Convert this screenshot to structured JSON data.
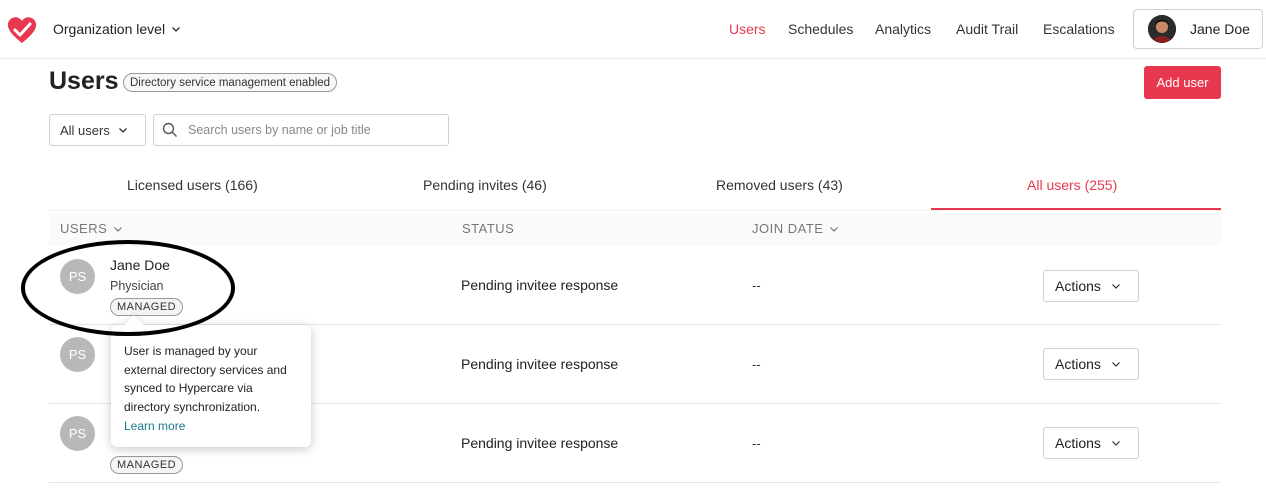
{
  "topbar": {
    "org_selector": "Organization level",
    "nav": [
      "Users",
      "Schedules",
      "Analytics",
      "Audit Trail",
      "Escalations"
    ],
    "active_nav": "Users",
    "user_name": "Jane Doe"
  },
  "page": {
    "title": "Users",
    "badge": "Directory service management enabled",
    "add_button": "Add user"
  },
  "filters": {
    "select_value": "All users",
    "search_placeholder": "Search users by name or job title"
  },
  "tabs": [
    {
      "label": "Licensed users (166)"
    },
    {
      "label": "Pending invites (46)"
    },
    {
      "label": "Removed users (43)"
    },
    {
      "label": "All users (255)",
      "active": true
    }
  ],
  "table": {
    "headers": {
      "users": "USERS",
      "status": "STATUS",
      "join_date": "JOIN DATE"
    },
    "rows": [
      {
        "initials": "PS",
        "name": "Jane Doe",
        "role": "Physician",
        "badge": "MANAGED",
        "status": "Pending invitee response",
        "join_date": "--",
        "action": "Actions"
      },
      {
        "initials": "PS",
        "name": "",
        "role": "",
        "badge": "",
        "status": "Pending invitee response",
        "join_date": "--",
        "action": "Actions"
      },
      {
        "initials": "PS",
        "name": "",
        "role": "",
        "badge": "MANAGED",
        "status": "Pending invitee response",
        "join_date": "--",
        "action": "Actions"
      }
    ]
  },
  "tooltip": {
    "text": "User is managed by your external directory services and synced to Hypercare via directory synchronization.",
    "link": "Learn more"
  },
  "colors": {
    "accent": "#e8384f",
    "link": "#1a7a8c",
    "avatar": "#b8b8b8"
  },
  "icons": [
    "heart-logo-icon",
    "chevron-down-icon",
    "search-icon"
  ]
}
